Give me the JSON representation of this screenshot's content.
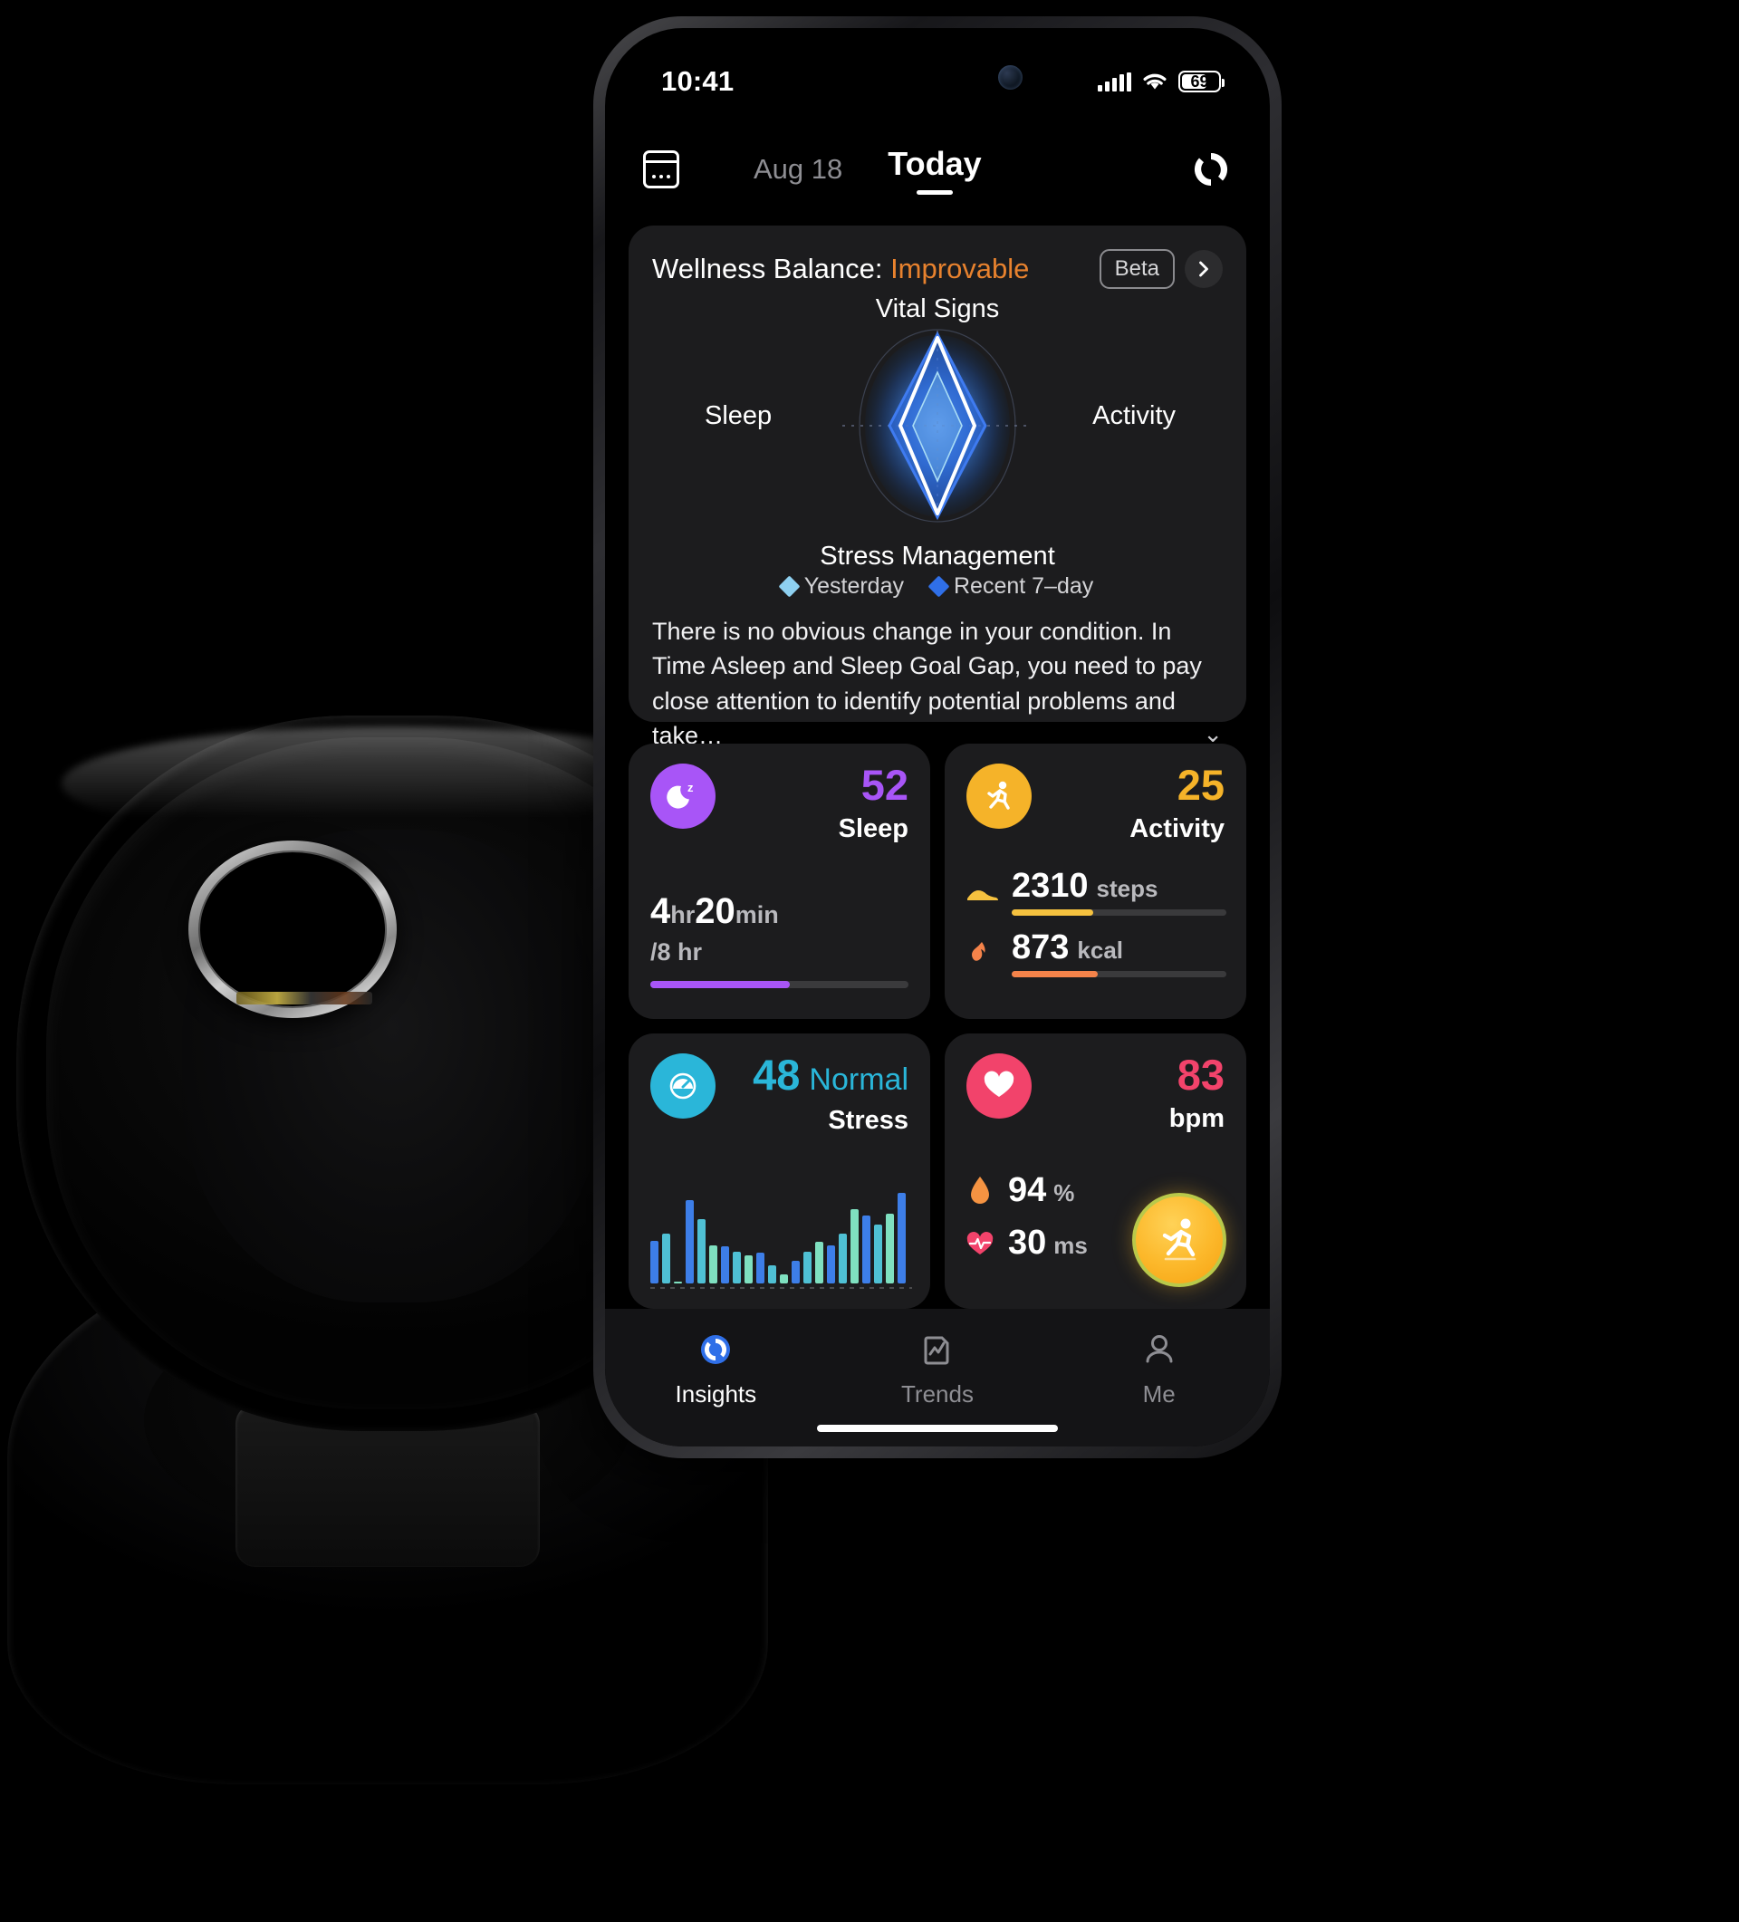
{
  "device": {
    "status_bar": {
      "time": "10:41",
      "battery_level": "69",
      "signal_icon": "signal-bars-icon",
      "wifi_icon": "wifi-icon",
      "battery_icon": "battery-icon"
    }
  },
  "app_header": {
    "calendar_icon": "calendar-icon",
    "date_label": "Aug 18",
    "today_label": "Today",
    "sync_icon": "sync-refresh-icon"
  },
  "wellness": {
    "title_prefix": "Wellness Balance: ",
    "status": "Improvable",
    "beta_badge": "Beta",
    "chevron_icon": "chevron-right-icon",
    "axes": {
      "top": "Vital Signs",
      "right": "Activity",
      "bottom": "Stress Management",
      "left": "Sleep"
    },
    "legend": [
      {
        "label": "Yesterday",
        "color": "#8ed0f0"
      },
      {
        "label": "Recent 7–day",
        "color": "#2f6fe8"
      }
    ],
    "description": "There is no obvious change in your condition. In Time Asleep and Sleep Goal Gap, you need to pay close attention to identify potential problems and take…",
    "expand_chevron": "⌄"
  },
  "metrics": {
    "sleep": {
      "icon": "moon-sleep-icon",
      "score": "52",
      "name": "Sleep",
      "accent": "#a855f7",
      "duration_hours": "4",
      "hours_unit": "hr",
      "duration_minutes": "20",
      "minutes_unit": "min",
      "goal": "/8 hr",
      "progress_percent": 54
    },
    "activity": {
      "icon": "running-person-icon",
      "score": "25",
      "name": "Activity",
      "accent": "#f5b329",
      "rows": [
        {
          "icon": "shoe-icon",
          "value": "2310",
          "unit": "steps",
          "percent": 38,
          "color": "#f5c13f"
        },
        {
          "icon": "flame-icon",
          "value": "873",
          "unit": "kcal",
          "percent": 40,
          "color": "#f5834a"
        }
      ]
    },
    "stress": {
      "icon": "gauge-icon",
      "score": "48",
      "level": "Normal",
      "name": "Stress",
      "accent": "#2ab6d9",
      "chart_values": [
        38,
        44,
        0,
        74,
        57,
        34,
        33,
        28,
        25,
        27,
        16,
        8,
        20,
        28,
        37,
        34,
        44,
        66,
        60,
        52,
        62,
        80
      ]
    },
    "heart": {
      "icon": "heart-icon",
      "value": "83",
      "unit": "bpm",
      "accent": "#f2436b",
      "rows": [
        {
          "icon": "blood-drop-icon",
          "value": "94",
          "unit": "%"
        },
        {
          "icon": "heartbeat-icon",
          "value": "30",
          "unit": "ms"
        }
      ],
      "fab_icon": "workout-run-icon"
    }
  },
  "tabbar": [
    {
      "label": "Insights",
      "icon": "insights-ring-icon",
      "active": true
    },
    {
      "label": "Trends",
      "icon": "trends-chart-icon",
      "active": false
    },
    {
      "label": "Me",
      "icon": "person-icon",
      "active": false
    }
  ],
  "product": {
    "name": "smart-ring-charging-case"
  }
}
